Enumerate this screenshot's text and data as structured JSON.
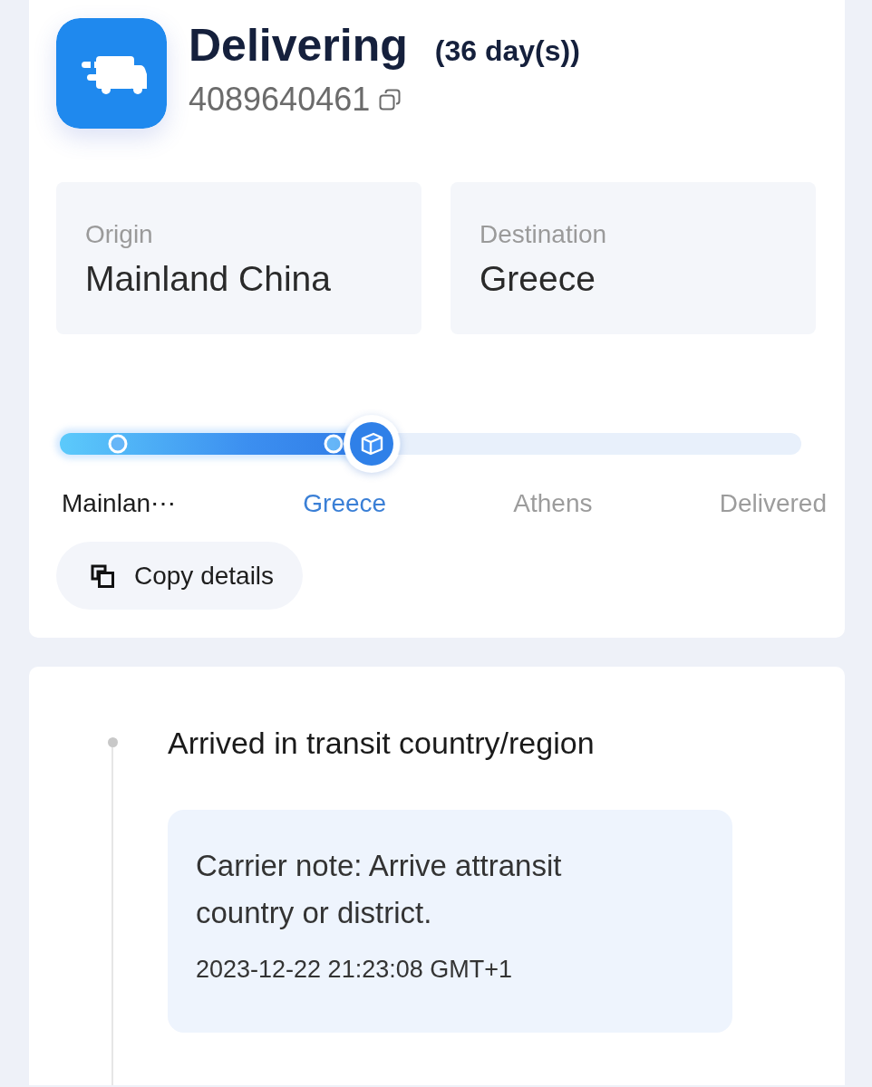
{
  "shipment": {
    "status": "Delivering",
    "duration": "(36 day(s))",
    "tracking_number": "4089640461"
  },
  "route": [
    {
      "label": "Origin",
      "value": "Mainland China"
    },
    {
      "label": "Destination",
      "value": "Greece"
    }
  ],
  "progress": {
    "level": 0.42,
    "steps": [
      {
        "label": "Mainlan⋯",
        "reached": true,
        "selected": false
      },
      {
        "label": "Greece",
        "reached": true,
        "selected": true
      },
      {
        "label": "Athens",
        "reached": false,
        "selected": false
      },
      {
        "label": "Delivered",
        "reached": false,
        "selected": false
      }
    ]
  },
  "copy_button": {
    "label": "Copy details"
  },
  "events": [
    {
      "title": "Arrived in transit country/region",
      "note": "Carrier note: Arrive attransit country or district.",
      "time": "2023-12-22 21:23:08 GMT+1"
    }
  ]
}
